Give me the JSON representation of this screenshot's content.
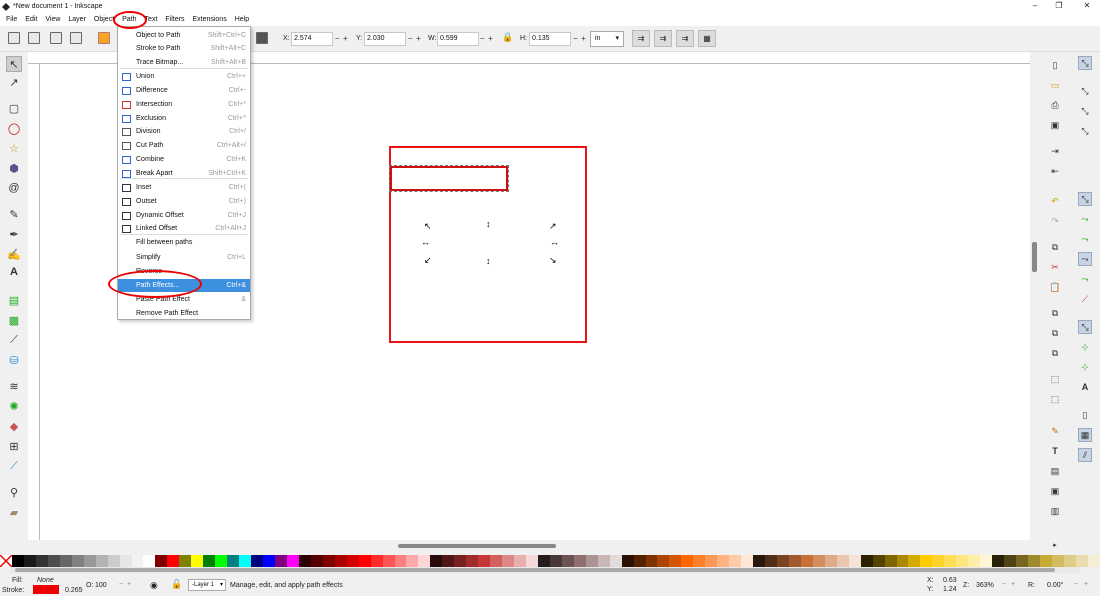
{
  "window": {
    "title": "*New document 1 - Inkscape",
    "minimize": "–",
    "maximize": "❐",
    "close": "✕"
  },
  "menubar": [
    "File",
    "Edit",
    "View",
    "Layer",
    "Object",
    "Path",
    "Text",
    "Filters",
    "Extensions",
    "Help"
  ],
  "toolbar": {
    "x_label": "X:",
    "x_value": "2.574",
    "y_label": "Y:",
    "y_value": "2.030",
    "w_label": "W:",
    "w_value": "0.599",
    "h_label": "H:",
    "h_value": "0.135",
    "units": "in"
  },
  "path_menu": {
    "items": [
      {
        "label": "Object to Path",
        "shortcut": "Shift+Ctrl+C",
        "icon": "none"
      },
      {
        "label": "Stroke to Path",
        "shortcut": "Shift+Alt+C",
        "icon": "none"
      },
      {
        "label": "Trace Bitmap...",
        "shortcut": "Shift+Alt+B",
        "icon": "none"
      },
      {
        "label": "Union",
        "shortcut": "Ctrl++",
        "icon": "union-icon"
      },
      {
        "label": "Difference",
        "shortcut": "Ctrl+-",
        "icon": "difference-icon"
      },
      {
        "label": "Intersection",
        "shortcut": "Ctrl+*",
        "icon": "intersection-icon"
      },
      {
        "label": "Exclusion",
        "shortcut": "Ctrl+^",
        "icon": "exclusion-icon"
      },
      {
        "label": "Division",
        "shortcut": "Ctrl+/",
        "icon": "division-icon"
      },
      {
        "label": "Cut Path",
        "shortcut": "Ctrl+Alt+/",
        "icon": "cut-path-icon"
      },
      {
        "label": "Combine",
        "shortcut": "Ctrl+K",
        "icon": "combine-icon"
      },
      {
        "label": "Break Apart",
        "shortcut": "Shift+Ctrl+K",
        "icon": "break-apart-icon"
      },
      {
        "label": "Inset",
        "shortcut": "Ctrl+(",
        "icon": "inset-icon"
      },
      {
        "label": "Outset",
        "shortcut": "Ctrl+)",
        "icon": "outset-icon"
      },
      {
        "label": "Dynamic Offset",
        "shortcut": "Ctrl+J",
        "icon": "dynamic-offset-icon"
      },
      {
        "label": "Linked Offset",
        "shortcut": "Ctrl+Alt+J",
        "icon": "linked-offset-icon"
      },
      {
        "label": "Fill between paths",
        "shortcut": "",
        "icon": "none"
      },
      {
        "label": "Simplify",
        "shortcut": "Ctrl+L",
        "icon": "none"
      },
      {
        "label": "Reverse",
        "shortcut": "",
        "icon": "none"
      },
      {
        "label": "Path Effects...",
        "shortcut": "Ctrl+&",
        "icon": "none",
        "highlighted": true
      },
      {
        "label": "Paste Path Effect",
        "shortcut": "&",
        "icon": "none"
      },
      {
        "label": "Remove Path Effect",
        "shortcut": "",
        "icon": "none"
      }
    ]
  },
  "status": {
    "fill_label": "Fill:",
    "fill_value": "None",
    "stroke_label": "Stroke:",
    "stroke_width": "0.265",
    "opacity_label": "O:",
    "opacity_value": "100",
    "layer": "-Layer 1",
    "message": "Manage, edit, and apply path effects",
    "x_label": "X:",
    "x_value": "0.63",
    "y_label": "Y:",
    "y_value": "1.24",
    "zoom_label": "Z:",
    "zoom_value": "363%",
    "rotate_label": "R:",
    "rotate_value": "0.00°"
  },
  "colors": {
    "accent": "#3d8fe0",
    "annotation_red": "#ee1111",
    "stroke_swatch": "#ee0000"
  },
  "palette": [
    "#000000",
    "#1a1a1a",
    "#333333",
    "#4d4d4d",
    "#666666",
    "#808080",
    "#999999",
    "#b3b3b3",
    "#cccccc",
    "#e6e6e6",
    "#f2f2f2",
    "#ffffff",
    "#800000",
    "#ff0000",
    "#808000",
    "#ffff00",
    "#008000",
    "#00ff00",
    "#008080",
    "#00ffff",
    "#000080",
    "#0000ff",
    "#800080",
    "#ff00ff",
    "#2b0000",
    "#550000",
    "#800000",
    "#aa0000",
    "#d40000",
    "#ff0000",
    "#ff2a2a",
    "#ff5555",
    "#ff8080",
    "#ffaaaa",
    "#ffd5d5",
    "#280b0b",
    "#501616",
    "#782121",
    "#a02c2c",
    "#c83737",
    "#d35f5f",
    "#de8787",
    "#e9afaf",
    "#f4d7d7",
    "#241c1c",
    "#483737",
    "#6c5353",
    "#916f6f",
    "#ac9393",
    "#c8b7b7",
    "#e3dbdb",
    "#2b1100",
    "#552200",
    "#803300",
    "#aa4400",
    "#d45500",
    "#ff6600",
    "#ff7f2a",
    "#ff9955",
    "#ffb380",
    "#ffccaa",
    "#ffe6d5",
    "#28170b",
    "#502d16",
    "#784421",
    "#a05a2c",
    "#c87137",
    "#d38d5f",
    "#deaa87",
    "#e9c6af",
    "#f4e3d7",
    "#2b2200",
    "#554400",
    "#806600",
    "#aa8800",
    "#d4aa00",
    "#ffcc00",
    "#ffd42a",
    "#ffdd55",
    "#ffe680",
    "#ffeeaa",
    "#fff6d5",
    "#28220b",
    "#504416",
    "#786721",
    "#a0892c",
    "#c8ab37",
    "#d3bc5f",
    "#decd87",
    "#e9ddaf",
    "#f4eed7"
  ]
}
